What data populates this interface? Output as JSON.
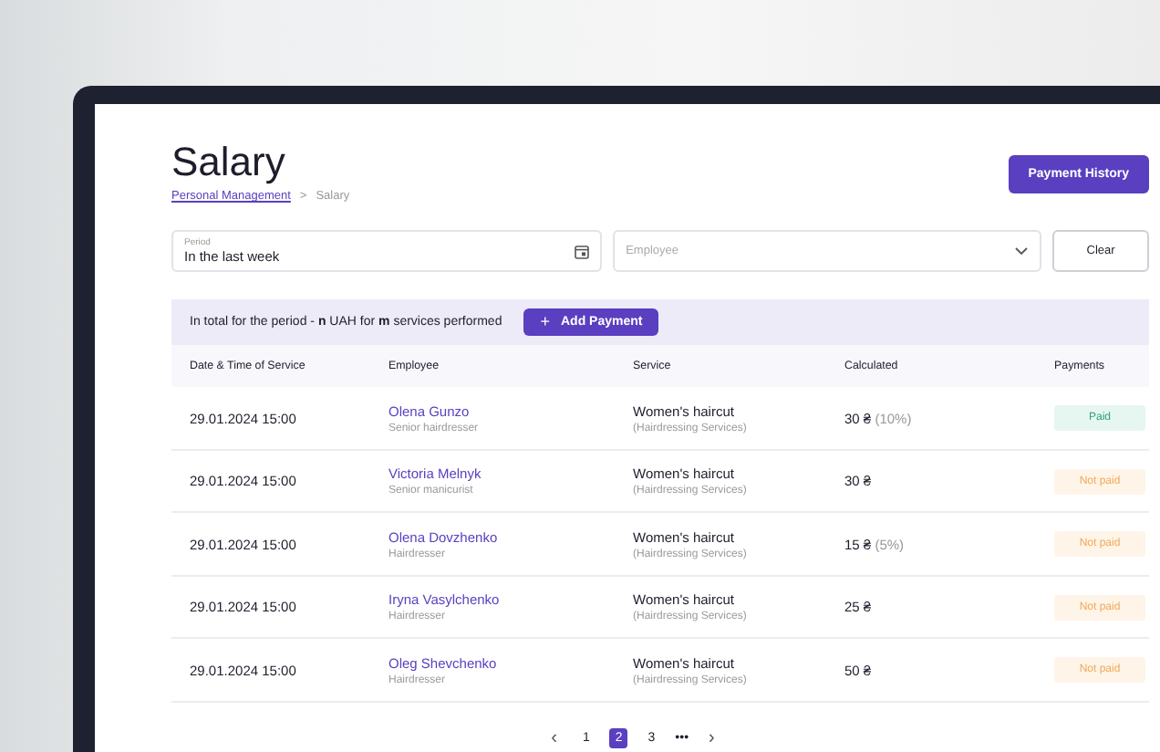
{
  "page": {
    "title": "Salary",
    "breadcrumb": [
      {
        "label": "Personal Management",
        "kind": "link"
      },
      {
        "label": ">",
        "kind": "separator"
      },
      {
        "label": "Salary",
        "kind": "current"
      }
    ],
    "action_button": "Payment History"
  },
  "filters": {
    "period": {
      "label": "Period",
      "value": "In the last week"
    },
    "employee": {
      "placeholder": "Employee"
    },
    "clear_button": "Clear"
  },
  "summary": {
    "text": "In total for the period - **n** UAH for **m** services performed",
    "add_button": "Add Payment",
    "add_icon": "+"
  },
  "table": {
    "columns": [
      "Date & Time of Service",
      "Employee",
      "Service",
      "Calculated",
      "Payments"
    ],
    "rows": [
      {
        "date": "29.01.2024 15:00",
        "employee": "Olena Gunzo",
        "role": "Senior hairdresser",
        "service": "Women's haircut",
        "category": "(Hairdressing Services)",
        "amount": "30 ₴",
        "percent": "(10%)",
        "payment": "Paid",
        "paid": true
      },
      {
        "date": "29.01.2024 15:00",
        "employee": "Victoria Melnyk",
        "role": "Senior manicurist",
        "service": "Women's haircut",
        "category": "(Hairdressing Services)",
        "amount": "30 ₴",
        "payment": "Not paid",
        "paid": false
      },
      {
        "date": "29.01.2024 15:00",
        "employee": "Olena Dovzhenko",
        "role": "Hairdresser",
        "service": "Women's haircut",
        "category": "(Hairdressing Services)",
        "amount": "15 ₴",
        "percent": "(5%)",
        "payment": "Not paid",
        "paid": false
      },
      {
        "date": "29.01.2024 15:00",
        "employee": "Iryna Vasylchenko",
        "role": "Hairdresser",
        "service": "Women's haircut",
        "category": "(Hairdressing Services)",
        "amount": "25 ₴",
        "payment": "Not paid",
        "paid": false
      },
      {
        "date": "29.01.2024 15:00",
        "employee": "Oleg Shevchenko",
        "role": "Hairdresser",
        "service": "Women's haircut",
        "category": "(Hairdressing Services)",
        "amount": "50 ₴",
        "payment": "Not paid",
        "paid": false
      }
    ]
  },
  "pagination": {
    "prev": "‹",
    "next": "›",
    "pages": [
      {
        "label": "1",
        "selected": false
      },
      {
        "label": "2",
        "selected": true
      },
      {
        "label": "3",
        "selected": false
      }
    ],
    "ellipsis": "•••"
  }
}
